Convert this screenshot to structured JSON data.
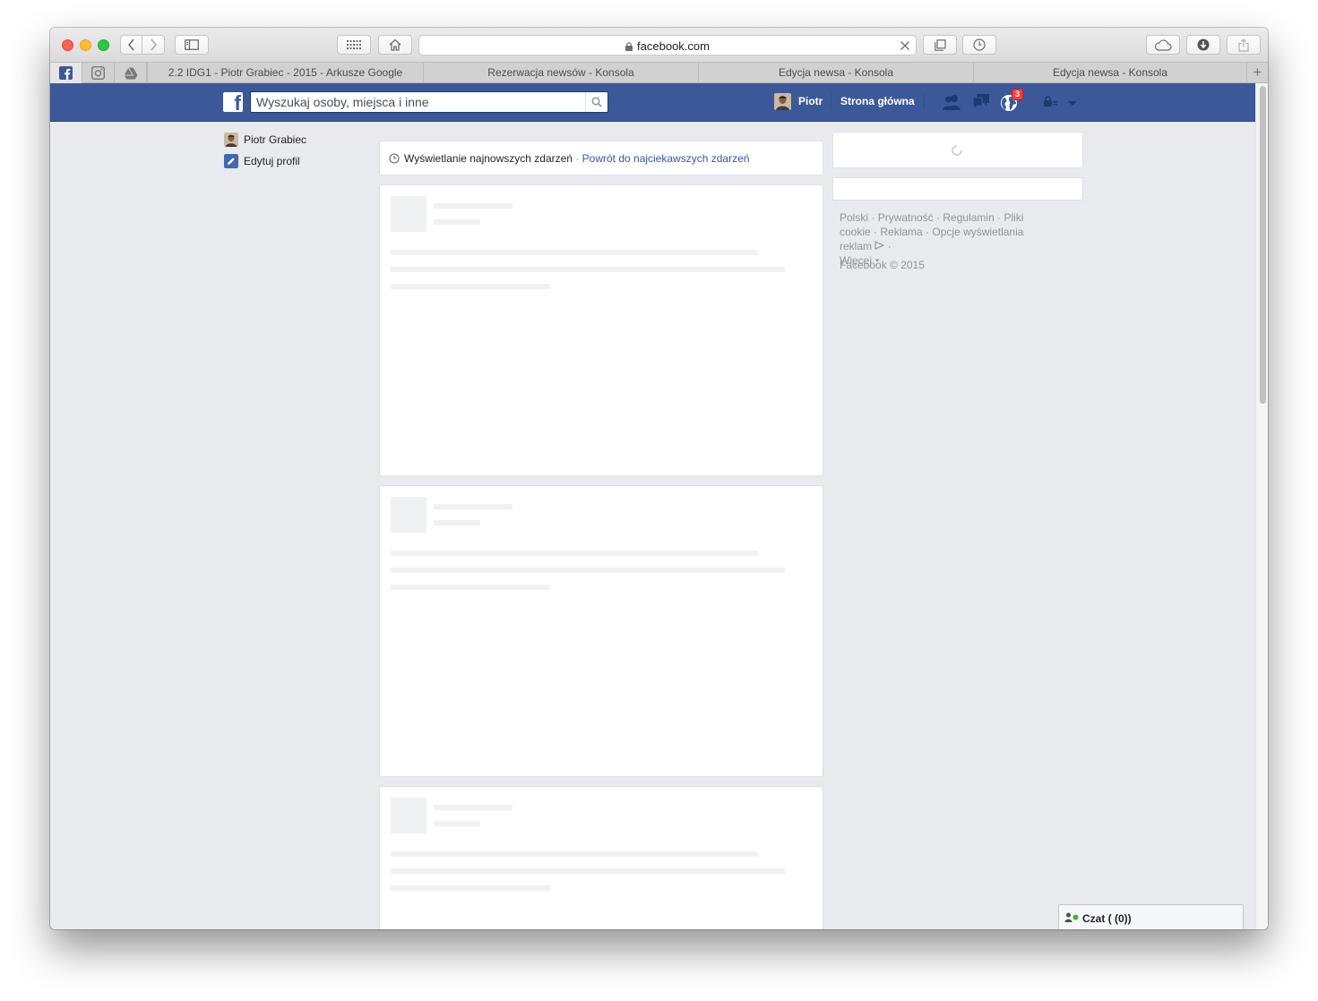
{
  "browser": {
    "url": "facebook.com",
    "tabs": [
      {
        "title": "2.2 IDG1 - Piotr Grabiec - 2015 - Arkusze Google"
      },
      {
        "title": "Rezerwacja newsów - Konsola"
      },
      {
        "title": "Edycja newsa - Konsola"
      },
      {
        "title": "Edycja newsa - Konsola"
      }
    ],
    "pinned_tabs": [
      "facebook-icon",
      "instagram-icon",
      "google-drive-icon"
    ],
    "new_tab_label": "+"
  },
  "header": {
    "search_placeholder": "Wyszukaj osoby, miejsca i inne",
    "user_name": "Piotr",
    "home_label": "Strona główna",
    "notifications_count": "3",
    "brand_color": "#3b5998",
    "badge_color": "#fa3e3e"
  },
  "left_nav": {
    "profile_name": "Piotr Grabiec",
    "edit_profile": "Edytuj profil"
  },
  "feed": {
    "sort_text": "Wyświetlanie najnowszych zdarzeń",
    "separator": " · ",
    "sort_link": "Powrót do najciekawszych zdarzeń"
  },
  "right_col": {
    "links": [
      "Polski",
      "Prywatność",
      "Regulamin",
      "Pliki cookie",
      "Reklama",
      "Opcje wyświetlania reklam",
      "Więcej"
    ],
    "copyright": "Facebook © 2015"
  },
  "chat": {
    "label": "Czat ( (0))",
    "status_color": "#42b72a"
  }
}
